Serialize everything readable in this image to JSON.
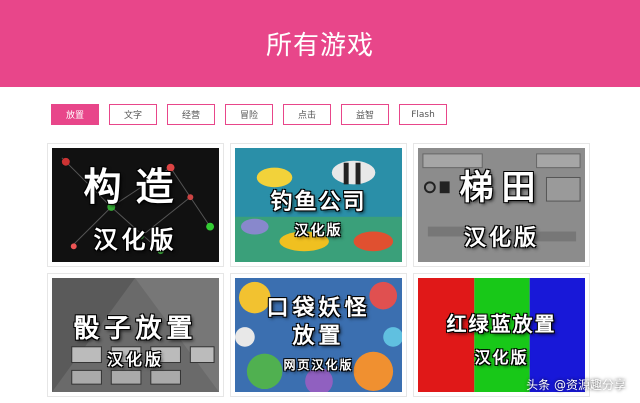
{
  "header": {
    "title": "所有游戏"
  },
  "filters": [
    {
      "label": "放置",
      "active": true
    },
    {
      "label": "文字",
      "active": false
    },
    {
      "label": "经营",
      "active": false
    },
    {
      "label": "冒险",
      "active": false
    },
    {
      "label": "点击",
      "active": false
    },
    {
      "label": "益智",
      "active": false
    },
    {
      "label": "Flash",
      "active": false
    }
  ],
  "games": [
    {
      "title": "构造",
      "subtitle": "汉化版"
    },
    {
      "title": "钓鱼公司",
      "subtitle": "汉化版"
    },
    {
      "title": "梯田",
      "subtitle": "汉化版"
    },
    {
      "title": "骰子放置",
      "subtitle": "汉化版"
    },
    {
      "title": "口袋妖怪",
      "title2": "放置",
      "subtitle": "网页汉化版"
    },
    {
      "title": "红绿蓝放置",
      "subtitle": "汉化版"
    }
  ],
  "watermark": "头条 @资源趣分享",
  "colors": {
    "accent": "#e8468a"
  }
}
